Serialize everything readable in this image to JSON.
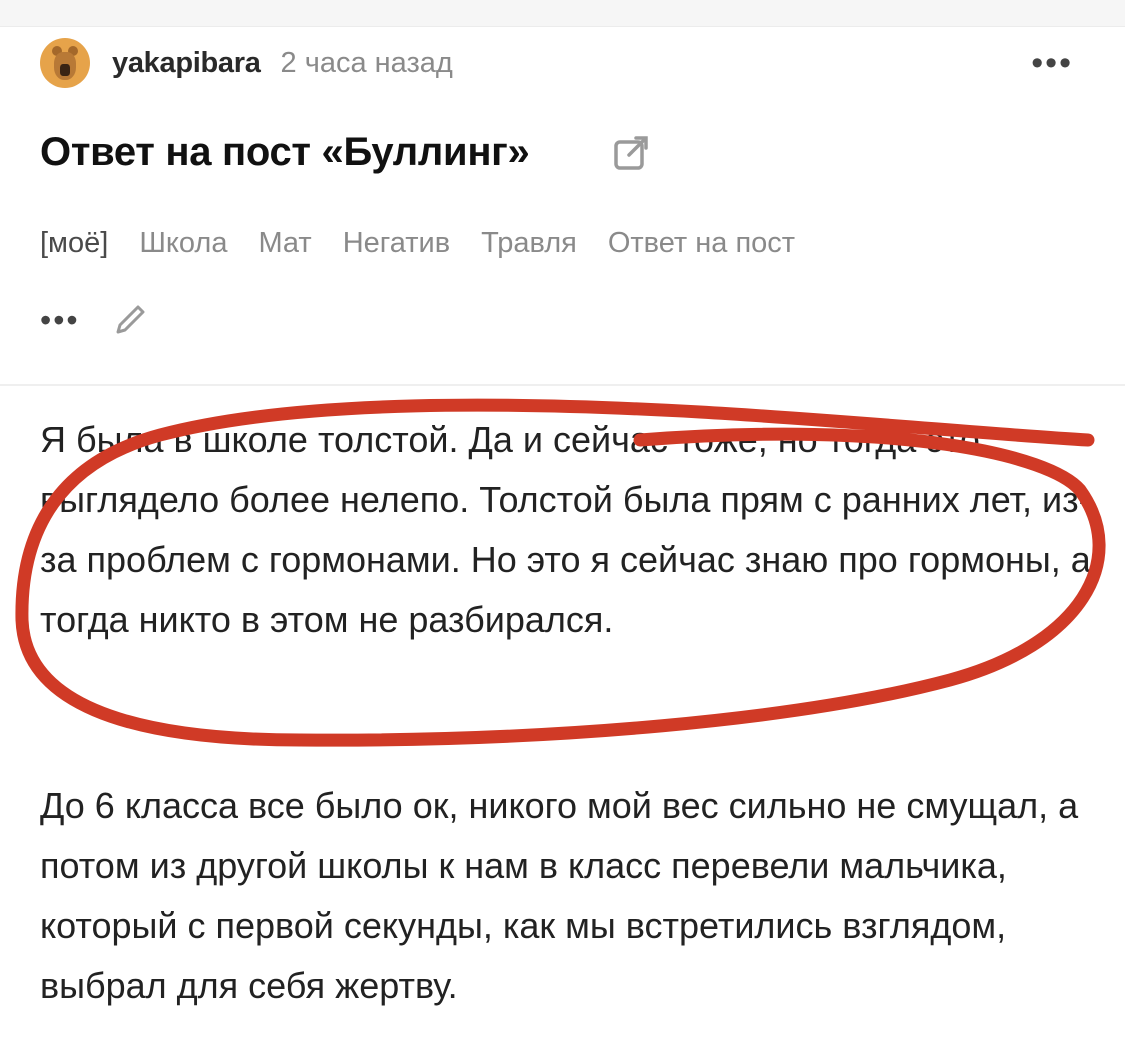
{
  "post": {
    "author": "yakapibara",
    "time": "2 часа назад",
    "title": "Ответ на пост «Буллинг»",
    "tags": [
      "[моё]",
      "Школа",
      "Мат",
      "Негатив",
      "Травля",
      "Ответ на пост"
    ],
    "more_glyph": "•••"
  },
  "icons": {
    "avatar": "capybara-avatar-icon",
    "menu": "more-icon",
    "share": "external-link-icon",
    "edit": "pencil-icon"
  },
  "content": {
    "paragraph1": "Я была в школе толстой. Да и сейчас тоже, но тогда это выглядело более нелепо. Толстой была прям с ранних лет, из-за проблем с гормонами. Но это я сейчас знаю про гормоны, а тогда никто в этом не разбирался.",
    "paragraph2": "До 6 класса все было ок, никого мой вес сильно не смущал, а потом из другой школы к нам в класс перевели мальчика, который с первой секунды, как мы встретились взглядом, выбрал для себя жертву."
  },
  "colors": {
    "annotation": "#d03a26",
    "muted": "#8a8a8a",
    "text": "#222222"
  }
}
